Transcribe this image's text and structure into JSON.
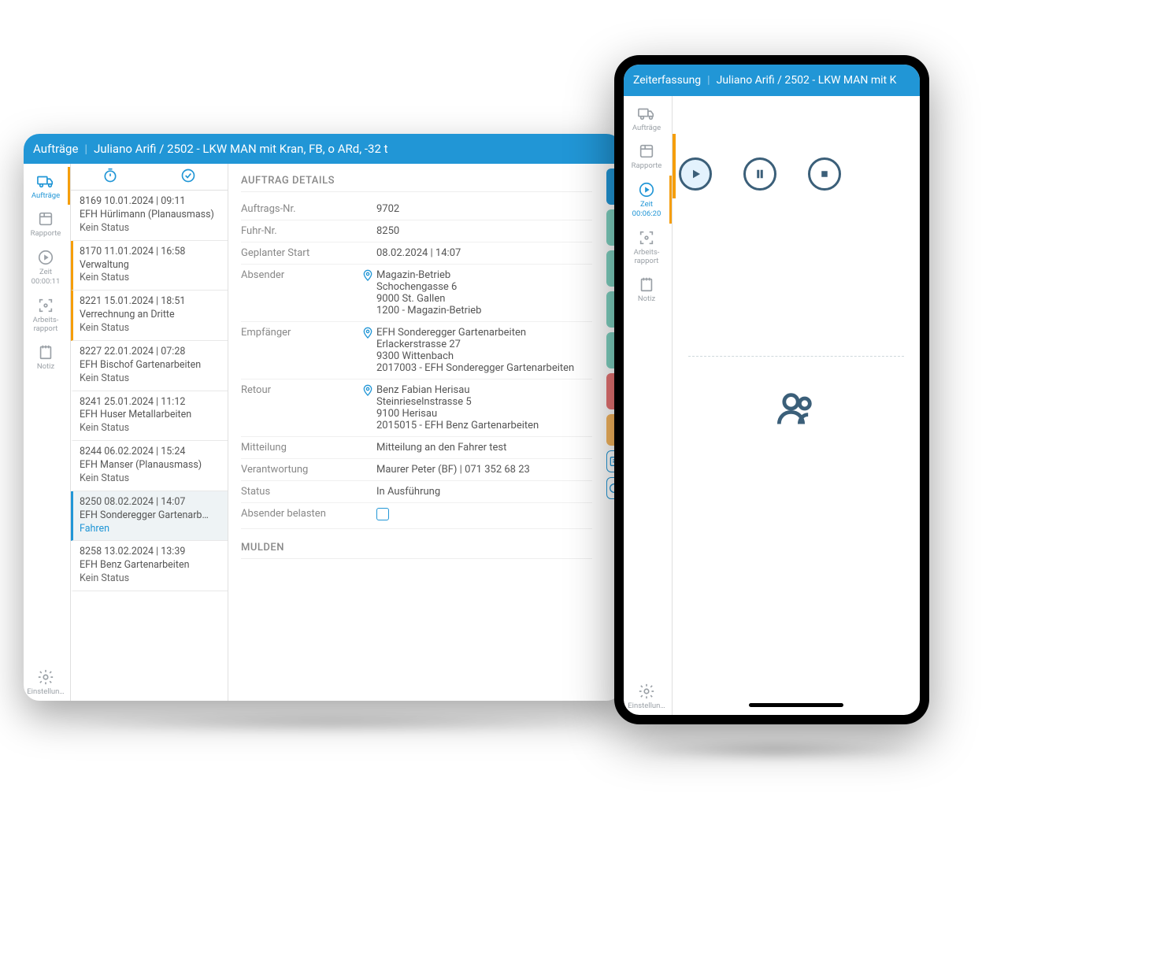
{
  "tablet": {
    "header": {
      "section": "Aufträge",
      "context": "Juliano Arifi / 2502 - LKW MAN mit Kran, FB, o ARd, -32 t"
    },
    "nav": {
      "auftraege": "Aufträge",
      "rapporte": "Rapporte",
      "zeit": "Zeit",
      "zeit_value": "00:00:11",
      "arbeitsrapport": "Arbeits-rapport",
      "notiz": "Notiz",
      "einstellungen": "Einstellun…"
    },
    "orders": [
      {
        "line1": "8169  10.01.2024 | 09:11",
        "line2": "EFH Hürlimann (Planausmass)",
        "line3": "Kein Status"
      },
      {
        "line1": "8170  11.01.2024 | 16:58",
        "line2": "Verwaltung",
        "line3": "Kein Status"
      },
      {
        "line1": "8221  15.01.2024 | 18:51",
        "line2": "Verrechnung an Dritte",
        "line3": "Kein Status"
      },
      {
        "line1": "8227  22.01.2024 | 07:28",
        "line2": "EFH Bischof Gartenarbeiten",
        "line3": "Kein Status"
      },
      {
        "line1": "8241  25.01.2024 | 11:12",
        "line2": "EFH Huser Metallarbeiten",
        "line3": "Kein Status"
      },
      {
        "line1": "8244  06.02.2024 | 15:24",
        "line2": "EFH Manser (Planausmass)",
        "line3": "Kein Status"
      },
      {
        "line1": "8250  08.02.2024 | 14:07",
        "line2": "EFH Sonderegger Gartenarb…",
        "line3": "Fahren"
      },
      {
        "line1": "8258  13.02.2024 | 13:39",
        "line2": "EFH Benz Gartenarbeiten",
        "line3": "Kein Status"
      }
    ],
    "details": {
      "title": "AUFTRAG DETAILS",
      "rows": {
        "auftragsnr_k": "Auftrags-Nr.",
        "auftragsnr_v": "9702",
        "fuhrnr_k": "Fuhr-Nr.",
        "fuhrnr_v": "8250",
        "start_k": "Geplanter Start",
        "start_v": "08.02.2024 | 14:07",
        "absender_k": "Absender",
        "absender_v1": "Magazin-Betrieb",
        "absender_v2": "Schochengasse 6",
        "absender_v3": "9000 St. Gallen",
        "absender_v4": "1200 - Magazin-Betrieb",
        "empf_k": "Empfänger",
        "empf_v1": "EFH Sonderegger Gartenarbeiten",
        "empf_v2": "Erlackerstrasse 27",
        "empf_v3": "9300 Wittenbach",
        "empf_v4": "2017003 - EFH Sonderegger Gartenarbeiten",
        "retour_k": "Retour",
        "retour_v1": "Benz Fabian Herisau",
        "retour_v2": "Steinrieselnstrasse 5",
        "retour_v3": "9100 Herisau",
        "retour_v4": "2015015 - EFH Benz Gartenarbeiten",
        "mitteilung_k": "Mitteilung",
        "mitteilung_v": "Mitteilung an den Fahrer test",
        "verantw_k": "Verantwortung",
        "verantw_v": "Maurer Peter (BF) | 071 352 68 23",
        "status_k": "Status",
        "status_v": "In Ausführung",
        "belasten_k": "Absender belasten"
      },
      "mulden_title": "MULDEN"
    }
  },
  "phone": {
    "header": {
      "section": "Zeiterfassung",
      "context": "Juliano Arifi / 2502 - LKW MAN mit K"
    },
    "nav": {
      "auftraege": "Aufträge",
      "rapporte": "Rapporte",
      "zeit": "Zeit",
      "zeit_value": "00:06:20",
      "arbeitsrapport": "Arbeits-rapport",
      "notiz": "Notiz",
      "einstellungen": "Einstellun…"
    }
  }
}
